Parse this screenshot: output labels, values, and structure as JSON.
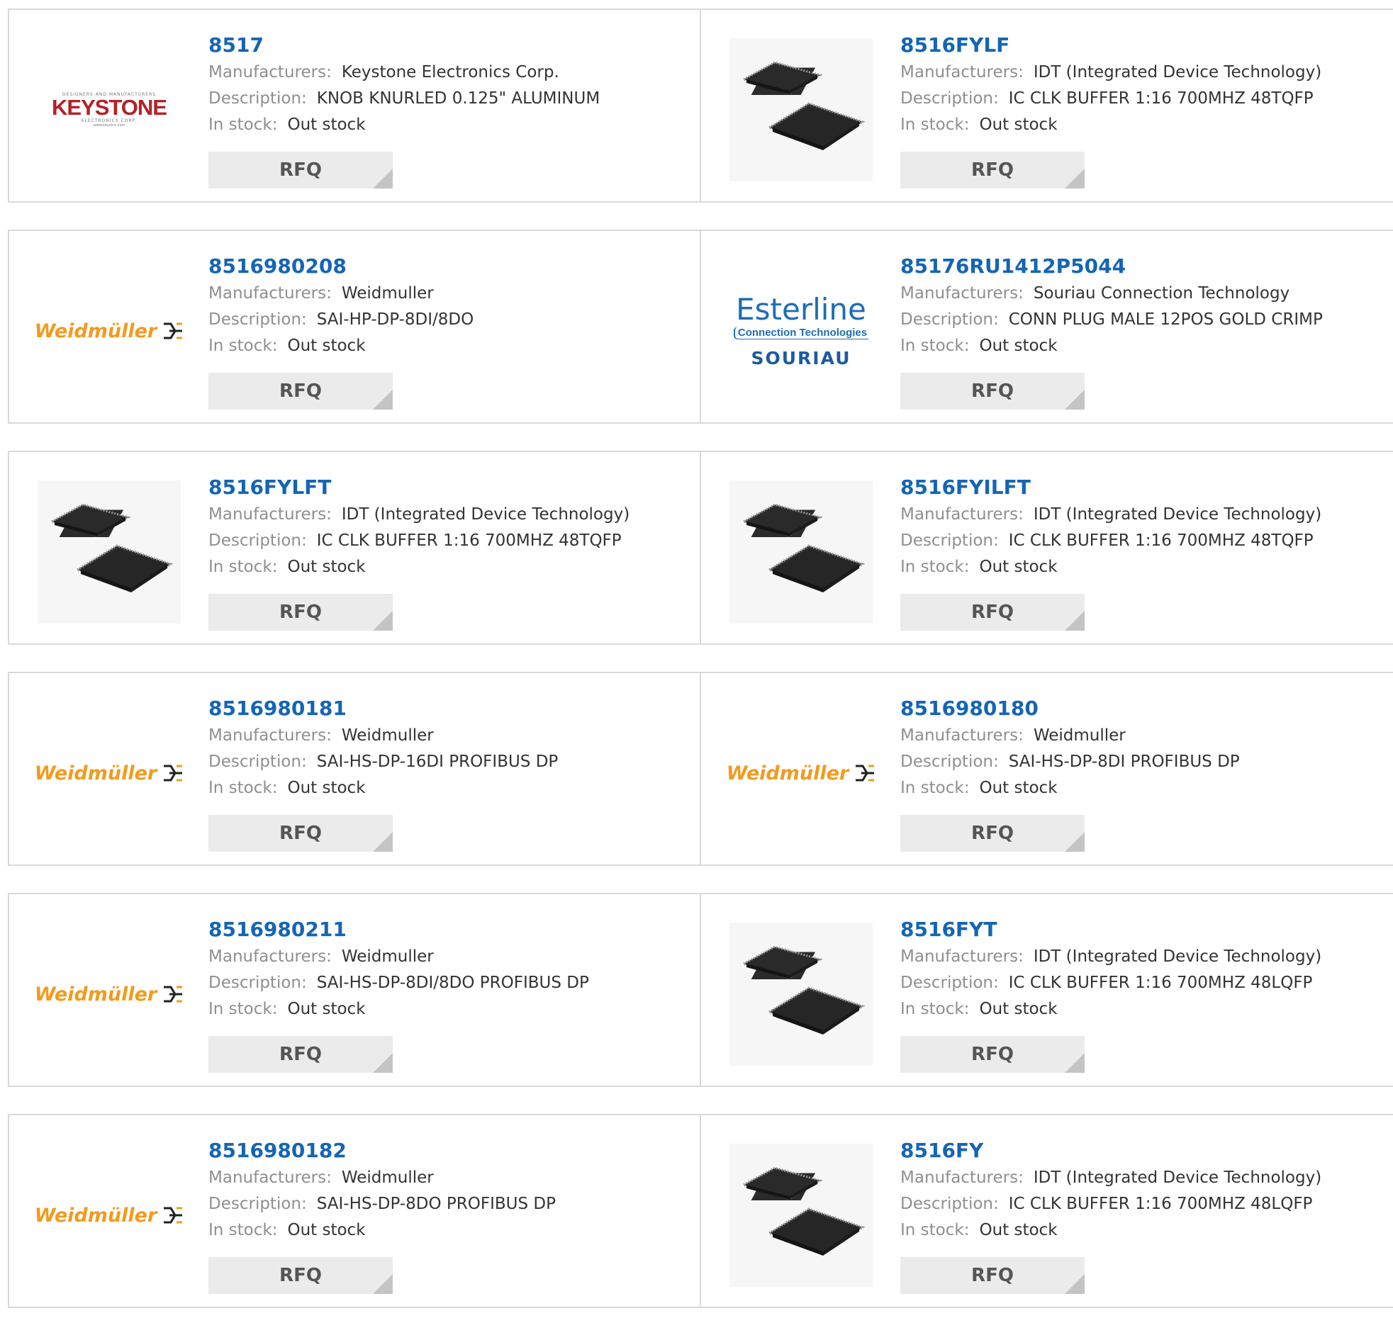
{
  "labels": {
    "manufacturers": "Manufacturers:",
    "description": "Description:",
    "in_stock": "In stock:",
    "rfq": "RFQ"
  },
  "logos": {
    "keystone": {
      "top": "DESIGNERS AND MANUFACTURERS",
      "name": "KEYSTONE",
      "sub": "ELECTRONICS CORP.",
      "url": "www.keyelco.com"
    },
    "weidmuller": {
      "name": "Weidmüller"
    },
    "esterline": {
      "name": "Esterline",
      "sub": "Connection Technologies",
      "brand": "SOURIAU"
    }
  },
  "products": [
    {
      "part": "8517",
      "manufacturer": "Keystone Electronics Corp.",
      "description": "KNOB KNURLED 0.125\" ALUMINUM",
      "stock": "Out stock",
      "image": "keystone-logo"
    },
    {
      "part": "8516FYLF",
      "manufacturer": "IDT (Integrated Device Technology)",
      "description": "IC CLK BUFFER 1:16 700MHZ 48TQFP",
      "stock": "Out stock",
      "image": "chip"
    },
    {
      "part": "8516980208",
      "manufacturer": "Weidmuller",
      "description": "SAI-HP-DP-8DI/8DO",
      "stock": "Out stock",
      "image": "weidmuller-logo"
    },
    {
      "part": "85176RU1412P5044",
      "manufacturer": "Souriau Connection Technology",
      "description": "CONN PLUG MALE 12POS GOLD CRIMP",
      "stock": "Out stock",
      "image": "esterline-logo"
    },
    {
      "part": "8516FYLFT",
      "manufacturer": "IDT (Integrated Device Technology)",
      "description": "IC CLK BUFFER 1:16 700MHZ 48TQFP",
      "stock": "Out stock",
      "image": "chip"
    },
    {
      "part": "8516FYILFT",
      "manufacturer": "IDT (Integrated Device Technology)",
      "description": "IC CLK BUFFER 1:16 700MHZ 48TQFP",
      "stock": "Out stock",
      "image": "chip"
    },
    {
      "part": "8516980181",
      "manufacturer": "Weidmuller",
      "description": "SAI-HS-DP-16DI PROFIBUS DP",
      "stock": "Out stock",
      "image": "weidmuller-logo"
    },
    {
      "part": "8516980180",
      "manufacturer": "Weidmuller",
      "description": "SAI-HS-DP-8DI PROFIBUS DP",
      "stock": "Out stock",
      "image": "weidmuller-logo"
    },
    {
      "part": "8516980211",
      "manufacturer": "Weidmuller",
      "description": "SAI-HS-DP-8DI/8DO PROFIBUS DP",
      "stock": "Out stock",
      "image": "weidmuller-logo"
    },
    {
      "part": "8516FYT",
      "manufacturer": "IDT (Integrated Device Technology)",
      "description": "IC CLK BUFFER 1:16 700MHZ 48LQFP",
      "stock": "Out stock",
      "image": "chip"
    },
    {
      "part": "8516980182",
      "manufacturer": "Weidmuller",
      "description": "SAI-HS-DP-8DO PROFIBUS DP",
      "stock": "Out stock",
      "image": "weidmuller-logo"
    },
    {
      "part": "8516FY",
      "manufacturer": "IDT (Integrated Device Technology)",
      "description": "IC CLK BUFFER 1:16 700MHZ 48LQFP",
      "stock": "Out stock",
      "image": "chip"
    }
  ],
  "colors": {
    "part_link": "#1565b4",
    "label": "#8f8f8f",
    "value": "#333333",
    "border": "#d9d9d9",
    "rfq_bg": "#ebebeb",
    "weidmuller_orange": "#f39a1e",
    "keystone_red": "#b52026",
    "esterline_blue": "#1d6db5"
  }
}
